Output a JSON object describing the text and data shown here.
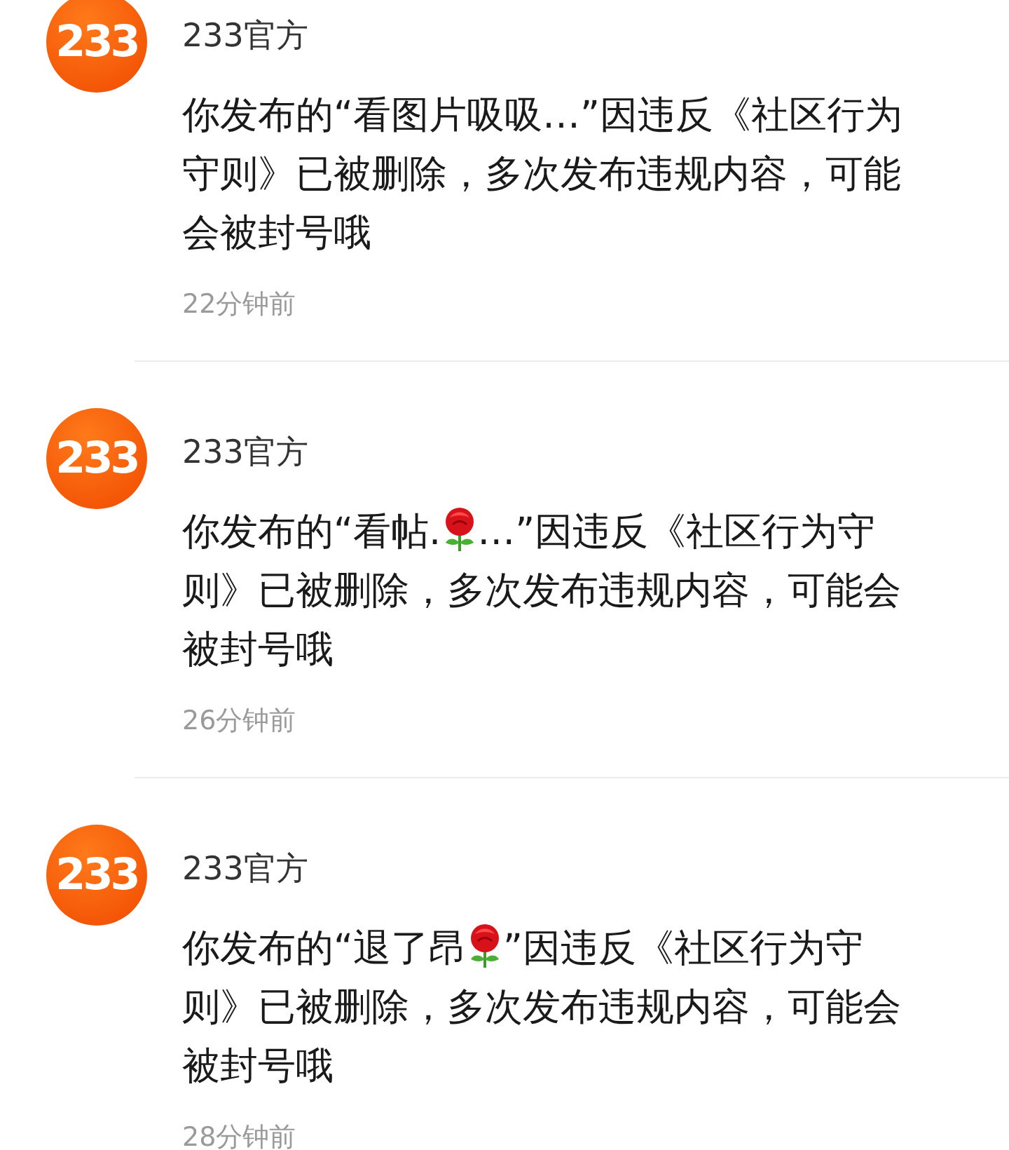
{
  "notifications": [
    {
      "avatar_text": "233",
      "sender": "233官方",
      "message": [
        {
          "kind": "text",
          "text": "你发布的“看图片吸吸…”因违反《社区行为守则》已被删除，多次发布违规内容，可能会被封号哦"
        }
      ],
      "time": "22分钟前"
    },
    {
      "avatar_text": "233",
      "sender": "233官方",
      "message": [
        {
          "kind": "text",
          "text": "你发布的“看帖."
        },
        {
          "kind": "rose"
        },
        {
          "kind": "text",
          "text": "…”因违反《社区行为守则》已被删除，多次发布违规内容，可能会被封号哦"
        }
      ],
      "time": "26分钟前"
    },
    {
      "avatar_text": "233",
      "sender": "233官方",
      "message": [
        {
          "kind": "text",
          "text": "你发布的“退了昂"
        },
        {
          "kind": "rose"
        },
        {
          "kind": "text",
          "text": "”因违反《社区行为守则》已被删除，多次发布违规内容，可能会被封号哦"
        }
      ],
      "time": "28分钟前"
    }
  ]
}
